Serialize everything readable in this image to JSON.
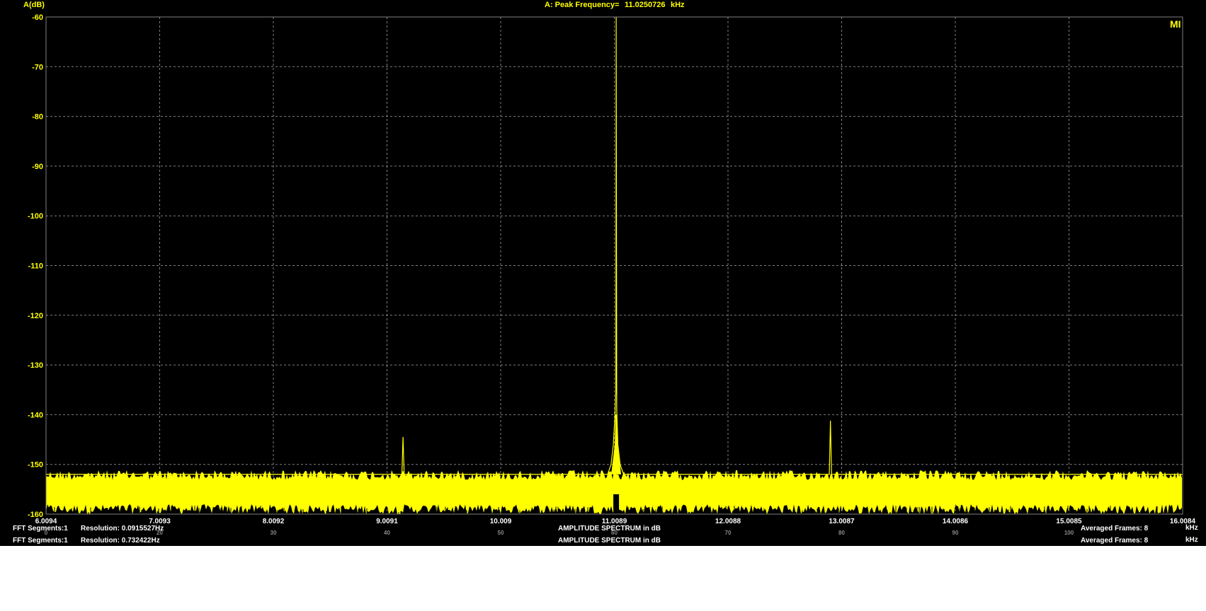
{
  "colors": {
    "background": "#000000",
    "trace": "#ffff00",
    "text_yellow": "#ffff00",
    "text_white": "#ffffff",
    "grid": "#808080"
  },
  "header": {
    "y_axis_title": "A(dB)",
    "peak_label": "A: Peak Frequency=",
    "peak_value": "11.0250726",
    "peak_unit": "kHz",
    "corner_tag": "MI"
  },
  "footer": {
    "rows": [
      {
        "segments": "FFT Segments:1",
        "resolution": "Resolution: 0.0915527Hz",
        "title": "AMPLITUDE SPECTRUM in dB",
        "frames": "Averaged Frames: 8",
        "unit": "kHz"
      },
      {
        "segments": "FFT Segments:1",
        "resolution": "Resolution: 0.732422Hz",
        "title": "AMPLITUDE SPECTRUM in dB",
        "frames": "Averaged Frames: 8",
        "unit": "kHz"
      }
    ],
    "ghost_ticks": [
      "0",
      "20",
      "30",
      "40",
      "50",
      "60",
      "70",
      "80",
      "90",
      "100"
    ]
  },
  "chart_data": {
    "type": "line",
    "title": "AMPLITUDE SPECTRUM in dB",
    "xlabel": "kHz",
    "ylabel": "A(dB)",
    "xlim": [
      6.0094,
      16.0084
    ],
    "ylim": [
      -160,
      -60
    ],
    "x_ticks": [
      "6.0094",
      "7.0093",
      "8.0092",
      "9.0091",
      "10.009",
      "11.0089",
      "12.0088",
      "13.0087",
      "14.0086",
      "15.0085",
      "16.0084"
    ],
    "y_ticks": [
      "-60",
      "-70",
      "-80",
      "-90",
      "-100",
      "-110",
      "-120",
      "-130",
      "-140",
      "-150",
      "-160"
    ],
    "grid": true,
    "noise_floor": {
      "upper_db": -152,
      "lower_db": -160
    },
    "series": [
      {
        "color": "#ffff00",
        "x": [
          6.0094,
          9.14,
          9.15,
          9.16,
          10.95,
          10.98,
          11.0,
          11.015,
          11.022,
          11.0250726,
          11.03,
          11.04,
          11.06,
          11.09,
          12.9,
          12.91,
          12.92,
          16.0084
        ],
        "y": [
          -152,
          -152,
          -144.5,
          -152,
          -152,
          -150,
          -146,
          -140,
          -135.5,
          -60,
          -139,
          -146,
          -150,
          -152,
          -152,
          -141.2,
          -152,
          -152
        ]
      }
    ]
  }
}
